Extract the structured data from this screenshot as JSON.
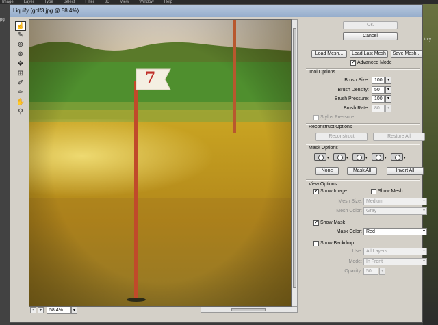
{
  "photoshop": {
    "menu": [
      "Image",
      "Layer",
      "Type",
      "Select",
      "Filter",
      "3D",
      "View",
      "Window",
      "Help"
    ],
    "left_tab": "pg",
    "right_text": "tory"
  },
  "dialog": {
    "title": "Liquify (golf3.jpg @ 58.4%)",
    "zoom": "58.4%",
    "zoom_out_label": "-",
    "zoom_in_label": "+",
    "flag_number": "7"
  },
  "tools": [
    {
      "icon": "forward-warp-icon",
      "glyph": "☝"
    },
    {
      "icon": "reconstruct-icon",
      "glyph": "✎"
    },
    {
      "icon": "twirl-icon",
      "glyph": "⊚"
    },
    {
      "icon": "pucker-icon",
      "glyph": "⊛"
    },
    {
      "icon": "bloat-icon",
      "glyph": "✥"
    },
    {
      "icon": "push-left-icon",
      "glyph": "⊞"
    },
    {
      "icon": "freeze-mask-icon",
      "glyph": "✐"
    },
    {
      "icon": "thaw-mask-icon",
      "glyph": "✑"
    },
    {
      "icon": "hand-icon",
      "glyph": "✋"
    },
    {
      "icon": "zoom-icon",
      "glyph": "⚲"
    }
  ],
  "buttons": {
    "ok": "OK",
    "cancel": "Cancel",
    "load_mesh": "Load Mesh...",
    "load_last_mesh": "Load Last Mesh",
    "save_mesh": "Save Mesh...",
    "reconstruct": "Reconstruct",
    "restore_all": "Restore All",
    "none": "None",
    "mask_all": "Mask All",
    "invert_all": "Invert All"
  },
  "advanced_mode": "Advanced Mode",
  "tool_options": {
    "heading": "Tool Options",
    "brush_size_label": "Brush Size:",
    "brush_size": "100",
    "brush_density_label": "Brush Density:",
    "brush_density": "50",
    "brush_pressure_label": "Brush Pressure:",
    "brush_pressure": "100",
    "brush_rate_label": "Brush Rate:",
    "brush_rate": "80",
    "stylus_pressure": "Stylus Pressure"
  },
  "reconstruct_options": {
    "heading": "Reconstruct Options"
  },
  "mask_options": {
    "heading": "Mask Options"
  },
  "view_options": {
    "heading": "View Options",
    "show_image": "Show Image",
    "show_mesh": "Show Mesh",
    "mesh_size_label": "Mesh Size:",
    "mesh_size": "Medium",
    "mesh_color_label": "Mesh Color:",
    "mesh_color": "Gray",
    "show_mask": "Show Mask",
    "mask_color_label": "Mask Color:",
    "mask_color": "Red",
    "show_backdrop": "Show Backdrop",
    "use_label": "Use:",
    "use": "All Layers",
    "mode_label": "Mode:",
    "mode": "In Front",
    "opacity_label": "Opacity:",
    "opacity": "50"
  },
  "checks": {
    "checked": "✔",
    "unchecked": ""
  },
  "arrows": {
    "down": "▾"
  }
}
